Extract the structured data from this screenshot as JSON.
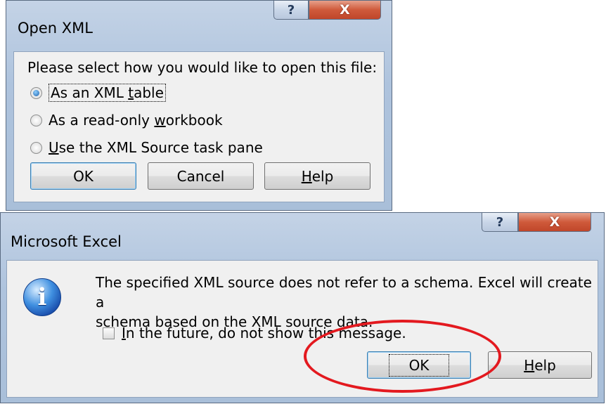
{
  "open_xml": {
    "title": "Open XML",
    "help_glyph": "?",
    "close_glyph": "X",
    "prompt": "Please select how you would like to open this file:",
    "options": [
      {
        "label": "As an XML table",
        "checked": true
      },
      {
        "label": "As a read-only workbook",
        "checked": false
      },
      {
        "label": "Use the XML Source task pane",
        "checked": false
      }
    ],
    "buttons": {
      "ok": "OK",
      "cancel": "Cancel",
      "help": "Help"
    }
  },
  "excel_message": {
    "title": "Microsoft Excel",
    "help_glyph": "?",
    "close_glyph": "X",
    "icon": "info-icon",
    "message_line1": "The specified XML source does not refer to a schema. Excel will create a",
    "message_line2": "schema based on the XML source data.",
    "checkbox_label": "In the future, do not show this message.",
    "checkbox_checked": false,
    "buttons": {
      "ok": "OK",
      "help": "Help"
    }
  },
  "annotation": {
    "color": "#e3191f"
  }
}
